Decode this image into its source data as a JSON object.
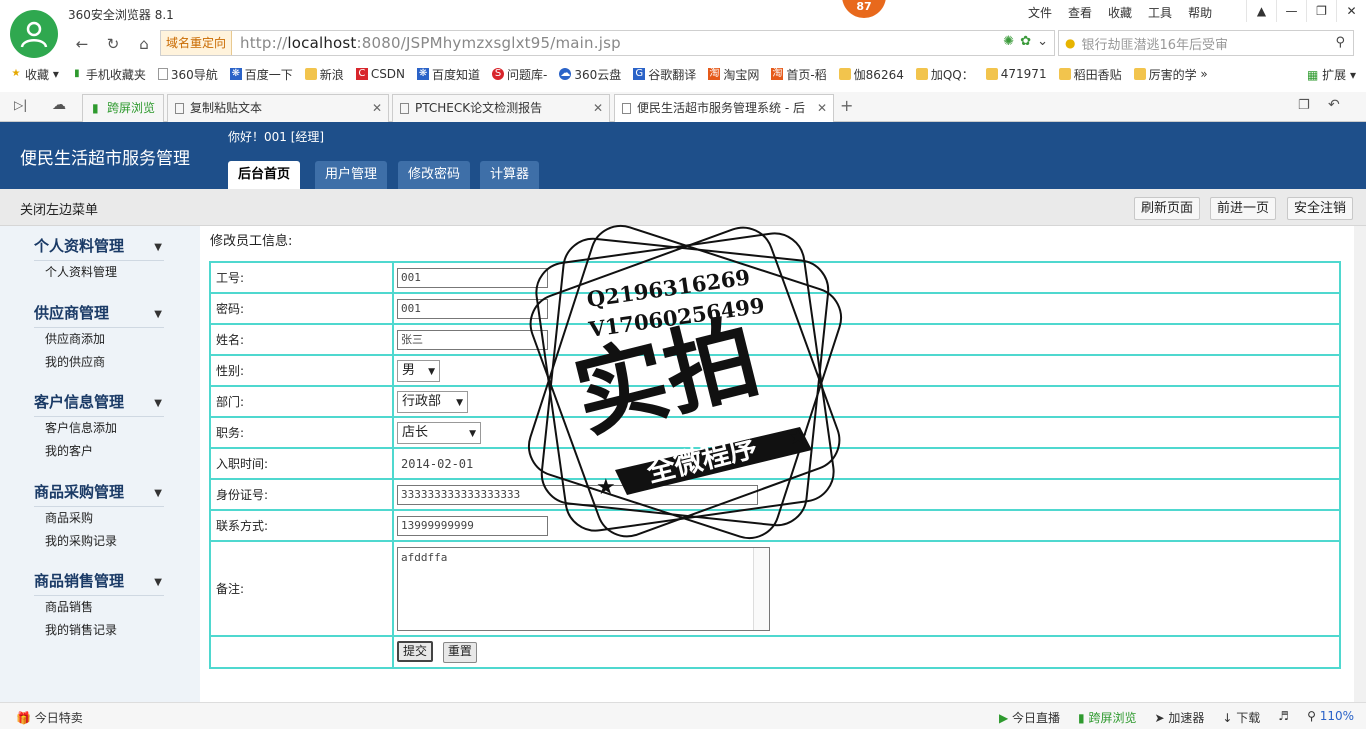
{
  "browser": {
    "title": "360安全浏览器 8.1",
    "badge_count": "87",
    "menu": [
      "文件",
      "查看",
      "收藏",
      "工具",
      "帮助"
    ],
    "redirect_label": "域名重定向",
    "url_prefix": "http://",
    "url_host": "localhost",
    "url_rest": ":8080/JSPMhymzxsglxt95/main.jsp",
    "search_placeholder": "银行劫匪潜逃16年后受审",
    "bookmarks": [
      "收藏",
      "手机收藏夹",
      "360导航",
      "百度一下",
      "新浪",
      "CSDN",
      "百度知道",
      "问题库-",
      "360云盘",
      "谷歌翻译",
      "淘宝网",
      "首页-稻",
      "伽86264",
      "加QQ：",
      "471971",
      "稻田香贴",
      "厉害的学"
    ],
    "extensions_label": "扩展",
    "tabs": [
      {
        "label": "跨屏浏览"
      },
      {
        "label": "复制粘贴文本"
      },
      {
        "label": "PTCHECK论文检测报告"
      },
      {
        "label": "便民生活超市服务管理系统 - 后"
      }
    ],
    "status_left": "今日特卖",
    "status_right": [
      "今日直播",
      "跨屏浏览",
      "加速器",
      "下载",
      "110%"
    ]
  },
  "app": {
    "name": "便民生活超市服务管理",
    "greeting": "你好！001 [经理]",
    "main_tabs": [
      "后台首页",
      "用户管理",
      "修改密码",
      "计算器"
    ],
    "toggle_menu": "关闭左边菜单",
    "top_buttons": [
      "刷新页面",
      "前进一页",
      "安全注销"
    ]
  },
  "sidebar": {
    "groups": [
      {
        "title": "个人资料管理",
        "items": [
          "个人资料管理"
        ]
      },
      {
        "title": "供应商管理",
        "items": [
          "供应商添加",
          "我的供应商"
        ]
      },
      {
        "title": "客户信息管理",
        "items": [
          "客户信息添加",
          "我的客户"
        ]
      },
      {
        "title": "商品采购管理",
        "items": [
          "商品采购",
          "我的采购记录"
        ]
      },
      {
        "title": "商品销售管理",
        "items": [
          "商品销售",
          "我的销售记录"
        ]
      }
    ]
  },
  "form": {
    "title": "修改员工信息:",
    "fields": {
      "emp_id": {
        "label": "工号:",
        "value": "001"
      },
      "password": {
        "label": "密码:",
        "value": "001"
      },
      "name": {
        "label": "姓名:",
        "value": "张三"
      },
      "gender": {
        "label": "性别:",
        "value": "男"
      },
      "department": {
        "label": "部门:",
        "value": "行政部"
      },
      "position": {
        "label": "职务:",
        "value": "店长"
      },
      "hire_date": {
        "label": "入职时间:",
        "value": "2014-02-01"
      },
      "id_number": {
        "label": "身份证号:",
        "value": "333333333333333333"
      },
      "contact": {
        "label": "联系方式:",
        "value": "13999999999"
      },
      "remark": {
        "label": "备注:",
        "value": "afddffa"
      }
    },
    "submit_label": "提交",
    "reset_label": "重置"
  },
  "stamp": {
    "line1": "Q2196316269",
    "line2": "V17060256499",
    "main": "实拍",
    "banner": "全微程序"
  }
}
